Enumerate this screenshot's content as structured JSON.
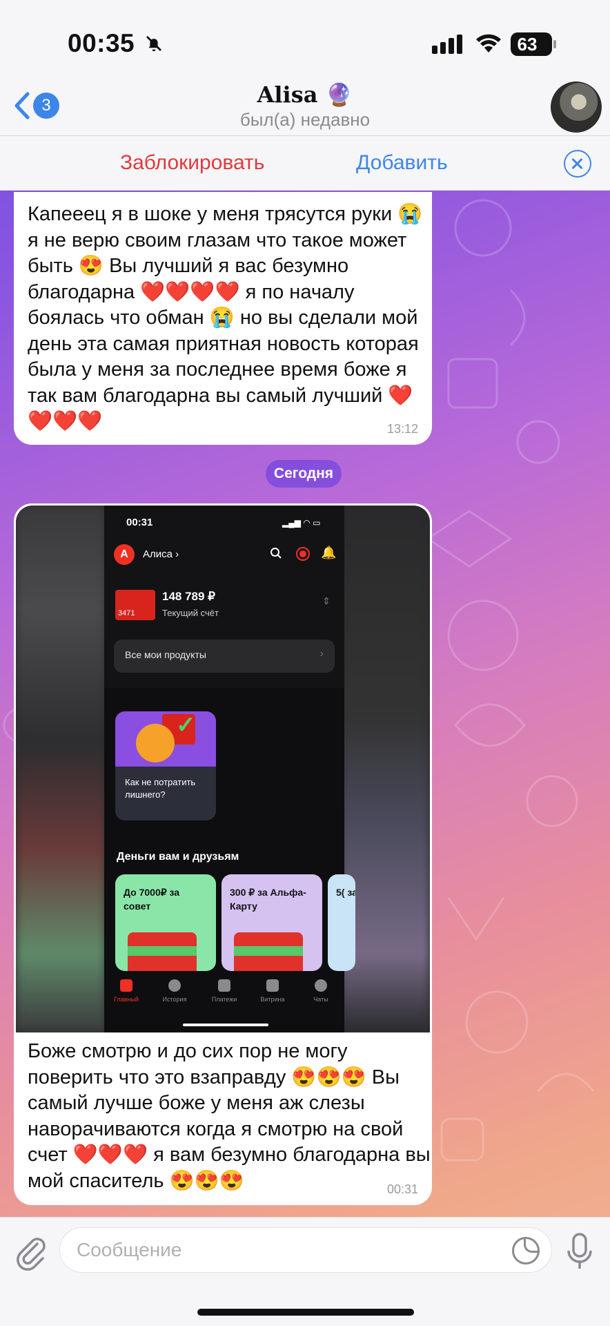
{
  "status_bar": {
    "time": "00:35",
    "battery": "63"
  },
  "header": {
    "back_count": "3",
    "title": "Alisa 🔮",
    "subtitle": "был(а) недавно"
  },
  "action_bar": {
    "block_label": "Заблокировать",
    "add_label": "Добавить"
  },
  "messages": [
    {
      "text": "Капееец я в шоке у меня трясутся руки 😭 я не верю своим глазам что такое может быть 😍 Вы лучший я вас безумно благодарна ❤️❤️❤️❤️ я  по началу боялась что обман 😭 но вы сделали мой день эта самая приятная новость которая была у меня за последнее время боже я так вам благодарна вы самый лучший ❤️❤️❤️❤️",
      "time": "13:12"
    },
    {
      "text": "Боже смотрю и до сих пор не могу поверить что это взаправду 😍😍😍 Вы самый лучше боже у меня аж слезы наворачиваются когда я смотрю на свой счет ❤️❤️❤️ я вам безумно благодарна вы мой спаситель 😍😍😍",
      "time": "00:31"
    }
  ],
  "date_separator": "Сегодня",
  "screenshot": {
    "time": "00:31",
    "logo": "А",
    "user": "Алиса ›",
    "card_digits": "3471",
    "amount": "148 789 ₽",
    "account_label": "Текущий счёт",
    "products_label": "Все мои продукты",
    "story_text": "Как не потратить лишнего?",
    "section_title": "Деньги вам и друзьям",
    "offers": [
      "До 7000₽ за совет",
      "300 ₽ за Альфа-Карту",
      "5( за"
    ],
    "tabs": [
      "Главный",
      "История",
      "Платежи",
      "Витрина",
      "Чаты"
    ]
  },
  "composer": {
    "placeholder": "Сообщение"
  }
}
